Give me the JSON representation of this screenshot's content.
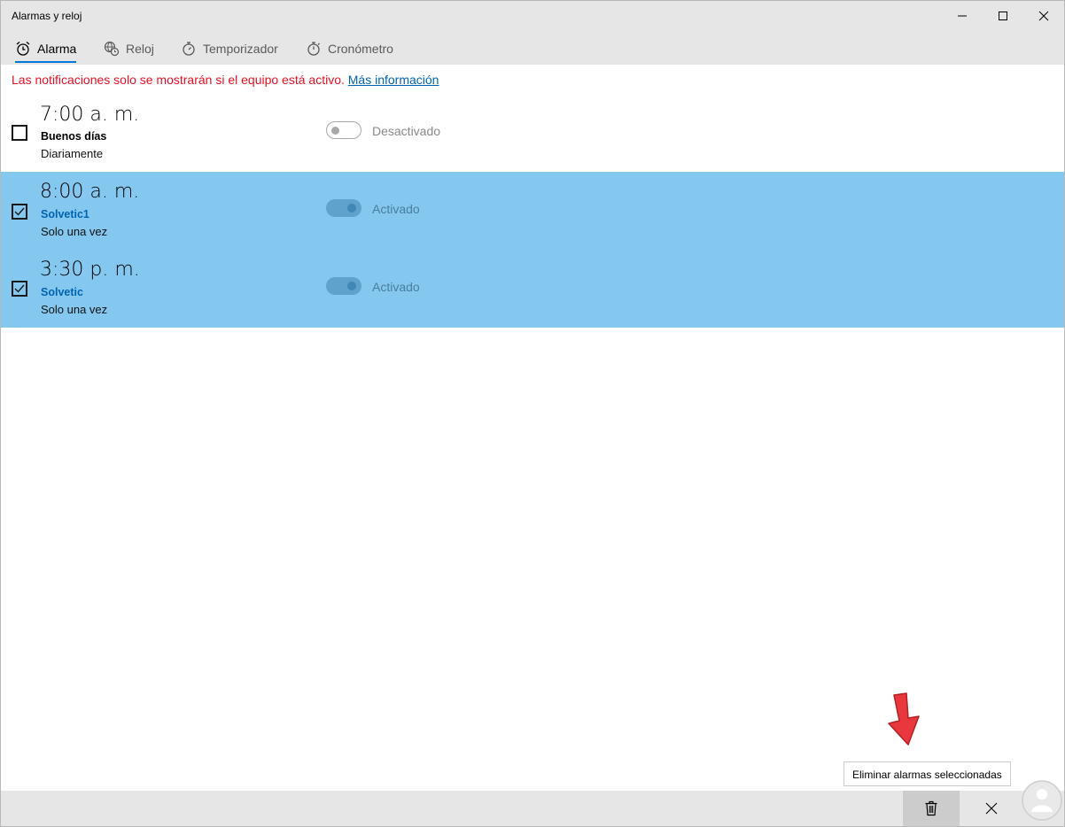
{
  "window": {
    "title": "Alarmas y reloj"
  },
  "tabs": [
    {
      "label": "Alarma",
      "icon": "alarm-clock-icon",
      "active": true
    },
    {
      "label": "Reloj",
      "icon": "world-clock-icon",
      "active": false
    },
    {
      "label": "Temporizador",
      "icon": "timer-icon",
      "active": false
    },
    {
      "label": "Cronómetro",
      "icon": "stopwatch-icon",
      "active": false
    }
  ],
  "notice": {
    "text": "Las notificaciones solo se mostrarán si el equipo está activo.",
    "link": "Más información"
  },
  "alarms": [
    {
      "time": "7:00 a. m.",
      "name": "Buenos días",
      "repeat": "Diariamente",
      "status": "Desactivado",
      "enabled": false,
      "checked": false
    },
    {
      "time": "8:00 a. m.",
      "name": "Solvetic1",
      "repeat": "Solo una vez",
      "status": "Activado",
      "enabled": true,
      "checked": true
    },
    {
      "time": "3:30 p. m.",
      "name": "Solvetic",
      "repeat": "Solo una vez",
      "status": "Activado",
      "enabled": true,
      "checked": true
    }
  ],
  "commandbar": {
    "delete_icon": "trash-icon",
    "cancel_icon": "close-icon",
    "delete_tooltip": "Eliminar alarmas seleccionadas"
  },
  "colors": {
    "accent": "#0078d7",
    "selection": "#84c8f0",
    "warning": "#e81123",
    "link": "#0063b1",
    "annotation_arrow": "#e8383d"
  }
}
